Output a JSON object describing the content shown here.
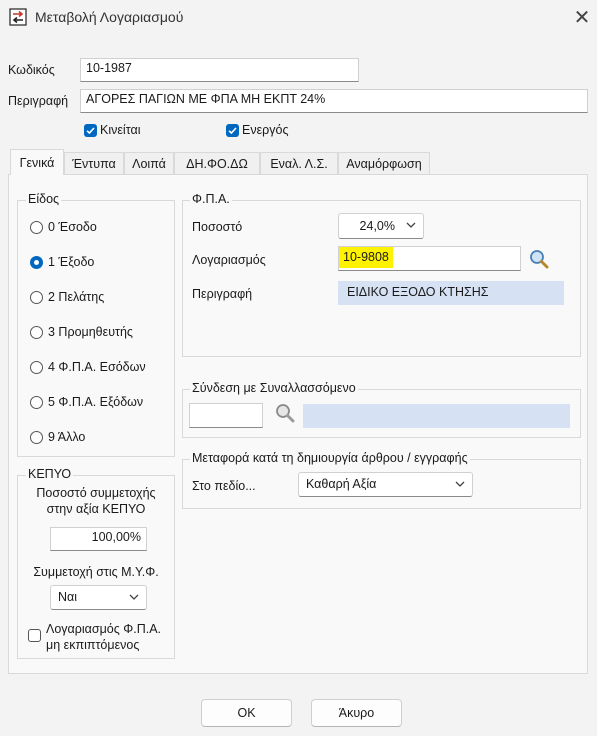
{
  "window": {
    "title": "Μεταβολή Λογαριασμού",
    "close_glyph": "✕"
  },
  "header": {
    "code_label": "Κωδικός",
    "code_value": "10-1987",
    "description_label": "Περιγραφή",
    "description_value": "ΑΓΟΡΕΣ ΠΑΓΙΩΝ ΜΕ ΦΠΑ ΜΗ ΕΚΠΤ 24%",
    "active_label": "Κινείται",
    "active_checked": true,
    "enabled_label": "Ενεργός",
    "enabled_checked": true
  },
  "tabs": [
    {
      "label": "Γενικά",
      "active": true
    },
    {
      "label": "Έντυπα",
      "active": false
    },
    {
      "label": "Λοιπά",
      "active": false
    },
    {
      "label": "ΔΗ.ΦΟ.ΔΩ",
      "active": false
    },
    {
      "label": "Εναλ. Λ.Σ.",
      "active": false
    },
    {
      "label": "Αναμόρφωση",
      "active": false
    }
  ],
  "type_group": {
    "title": "Είδος",
    "options": [
      {
        "label": "0 Έσοδο",
        "selected": false
      },
      {
        "label": "1 Έξοδο",
        "selected": true
      },
      {
        "label": "2 Πελάτης",
        "selected": false
      },
      {
        "label": "3 Προμηθευτής",
        "selected": false
      },
      {
        "label": "4 Φ.Π.Α. Εσόδων",
        "selected": false
      },
      {
        "label": "5 Φ.Π.Α. Εξόδων",
        "selected": false
      },
      {
        "label": "9 Άλλο",
        "selected": false
      }
    ]
  },
  "vat_group": {
    "title": "Φ.Π.Α.",
    "rate_label": "Ποσοστό",
    "rate_value": "24,0%",
    "account_label": "Λογαριασμός",
    "account_value": "10-9808",
    "account_highlight": "#fff200",
    "desc_label": "Περιγραφή",
    "desc_value": "ΕΙΔΙΚΟ ΕΞΟΔΟ ΚΤΗΣΗΣ",
    "search_icon": "search-icon"
  },
  "link_group": {
    "title": "Σύνδεση με Συναλλασσόμενο",
    "code_value": "",
    "name_value": ""
  },
  "transfer_group": {
    "title": "Μεταφορά κατά τη δημιουργία άρθρου / εγγραφής",
    "field_label": "Στο πεδίο...",
    "field_value": "Καθαρή Αξία"
  },
  "kepyo_group": {
    "title": "ΚΕΠΥΟ",
    "participation_line1": "Ποσοστό συμμετοχής",
    "participation_line2": "στην αξία ΚΕΠΥΟ",
    "participation_value": "100,00%",
    "myf_label": "Συμμετοχή στις Μ.Υ.Φ.",
    "myf_value": "Ναι",
    "vat_nondeductible_line1": "Λογαριασμός Φ.Π.Α.",
    "vat_nondeductible_line2": "μη εκπιπτόμενος",
    "vat_nondeductible_checked": false
  },
  "buttons": {
    "ok": "OK",
    "cancel": "Άκυρο"
  },
  "colors": {
    "accent": "#0067c0",
    "readonly_fill": "#d6e2f3"
  }
}
